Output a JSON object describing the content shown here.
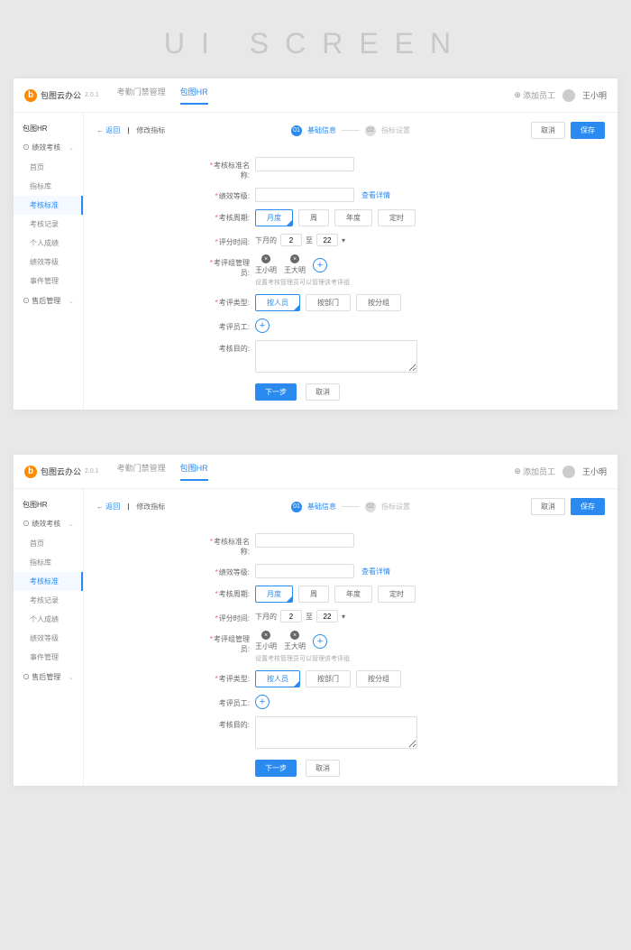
{
  "page_title": "UI SCREEN",
  "logo": {
    "icon": "b",
    "name": "包图云办公",
    "version": "2.0.1"
  },
  "top_tabs": [
    {
      "label": "考勤门禁管理",
      "active": false
    },
    {
      "label": "包图HR",
      "active": true
    }
  ],
  "top_right": {
    "add_label": "添加员工",
    "user_name": "王小明"
  },
  "sidebar": {
    "title": "包图HR",
    "section_1": "绩效考核",
    "items_1": [
      {
        "label": "首页"
      },
      {
        "label": "指标库"
      },
      {
        "label": "考核标准"
      },
      {
        "label": "考核记录"
      },
      {
        "label": "个人成绩"
      },
      {
        "label": "绩效等级"
      },
      {
        "label": "事件管理"
      }
    ],
    "section_2": "售后管理"
  },
  "breadcrumb": {
    "back": "返回",
    "divider": "|",
    "current": "修改指标"
  },
  "steps": {
    "s1_num": "01",
    "s1_label": "基础信息",
    "s2_num": "02",
    "s2_label": "指标设置"
  },
  "actions": {
    "cancel": "取消",
    "save": "保存"
  },
  "form": {
    "name_label": "考核标准名称:",
    "level_label": "绩效等级:",
    "level_link": "查看详情",
    "scope_label": "考核周期:",
    "scope_options": [
      "月度",
      "周",
      "年度",
      "定时"
    ],
    "date_label": "评分时间:",
    "date_prefix": "下月的",
    "date_from": "2",
    "date_mid": "至",
    "date_to": "22",
    "manager_label": "考评组管理员:",
    "managers": [
      "王小明",
      "王大明"
    ],
    "manager_hint": "设置考核管理员可以管理该考评组",
    "type_label": "考评类型:",
    "type_options": [
      "按人员",
      "按部门",
      "按分组"
    ],
    "staff_label": "考评员工:",
    "purpose_label": "考核目的:",
    "next_btn": "下一步",
    "cancel_btn": "取消"
  }
}
